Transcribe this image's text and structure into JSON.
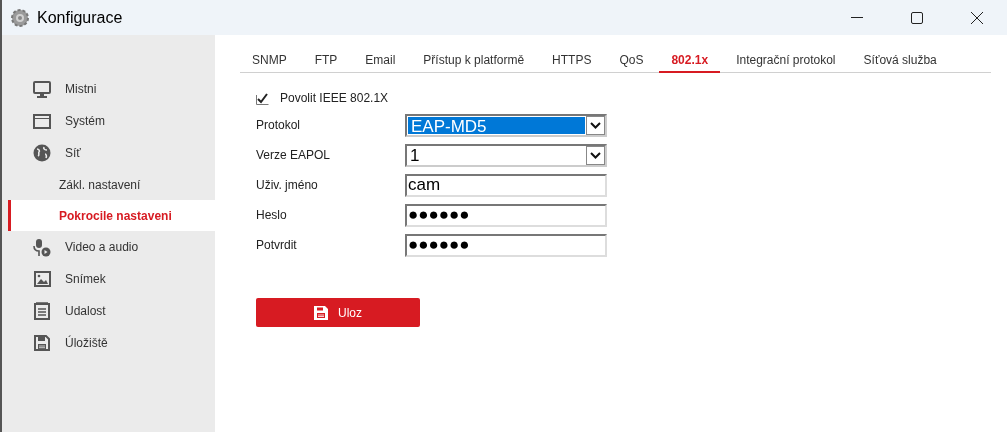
{
  "window": {
    "title": "Konfigurace"
  },
  "sidebar": {
    "items": [
      {
        "label": "Mistni",
        "selected": false
      },
      {
        "label": "Systém",
        "selected": false
      },
      {
        "label": "Síť",
        "selected": false,
        "expanded": true,
        "children": [
          {
            "label": "Zákl. nastavení",
            "selected": false
          },
          {
            "label": "Pokrocile nastaveni",
            "selected": true
          }
        ]
      },
      {
        "label": "Video a audio",
        "selected": false
      },
      {
        "label": "Snímek",
        "selected": false
      },
      {
        "label": "Udalost",
        "selected": false
      },
      {
        "label": "Úložiště",
        "selected": false
      }
    ]
  },
  "tabs": [
    {
      "label": "SNMP",
      "selected": false
    },
    {
      "label": "FTP",
      "selected": false
    },
    {
      "label": "Email",
      "selected": false
    },
    {
      "label": "Přístup k platformě",
      "selected": false
    },
    {
      "label": "HTTPS",
      "selected": false
    },
    {
      "label": "QoS",
      "selected": false
    },
    {
      "label": "802.1x",
      "selected": true
    },
    {
      "label": "Integrační protokol",
      "selected": false
    },
    {
      "label": "Síťová služba",
      "selected": false
    }
  ],
  "form": {
    "enable": {
      "label": "Povolit IEEE 802.1X",
      "checked": true
    },
    "fields": [
      {
        "kind": "select",
        "label": "Protokol",
        "value": "EAP-MD5",
        "focused": true
      },
      {
        "kind": "select",
        "label": "Verze EAPOL",
        "value": "1",
        "focused": false
      },
      {
        "kind": "text",
        "label": "Uživ. jméno",
        "value": "cam"
      },
      {
        "kind": "text",
        "label": "Heslo",
        "value": "●●●●●●"
      },
      {
        "kind": "text",
        "label": "Potvrdit",
        "value": "●●●●●●"
      }
    ]
  },
  "save_button": {
    "label": "Uloz"
  }
}
